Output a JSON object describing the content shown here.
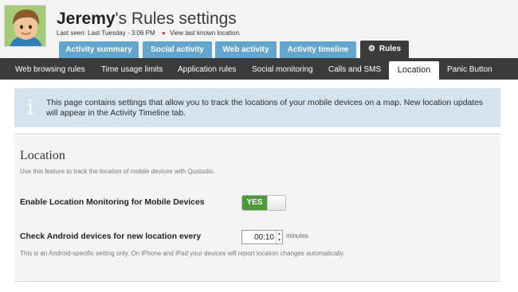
{
  "header": {
    "child_name": "Jeremy",
    "title_suffix": "'s Rules settings",
    "last_seen": "Last seen: Last Tuesday - 3:06 PM",
    "location_link": "View last known location."
  },
  "top_tabs": [
    {
      "label": "Activity summary"
    },
    {
      "label": "Social activity"
    },
    {
      "label": "Web activity"
    },
    {
      "label": "Activity timeline"
    },
    {
      "label": "Rules"
    }
  ],
  "sub_tabs": [
    {
      "label": "Web browsing rules"
    },
    {
      "label": "Time usage limits"
    },
    {
      "label": "Application rules"
    },
    {
      "label": "Social monitoring"
    },
    {
      "label": "Calls and SMS"
    },
    {
      "label": "Location"
    },
    {
      "label": "Panic Button"
    }
  ],
  "info": {
    "text": "This page contains settings that allow you to track the locations of your mobile devices on a map. New location updates will appear in the Activity Timeline tab."
  },
  "section": {
    "title": "Location",
    "description": "Use this feature to track the location of mobile devices with Qustodio.",
    "enable_label": "Enable Location Monitoring for Mobile Devices",
    "toggle_label": "YES",
    "toggle_on": true,
    "check_label": "Check Android devices for new location every",
    "interval_value": "00:10",
    "interval_unit": "minutes",
    "note": "This is an Android-specific setting only. On iPhone and iPad your devices will report location changes automatically."
  },
  "colors": {
    "tab_blue": "#62a6cf",
    "nav_dark": "#3b3b3b",
    "toggle_green": "#4e9a3b",
    "info_bg": "#d4e3ed"
  },
  "icons": {
    "avatar": "child-avatar",
    "location": "map-pin-icon",
    "rules_tab": "gear-icon",
    "info": "info-icon"
  }
}
